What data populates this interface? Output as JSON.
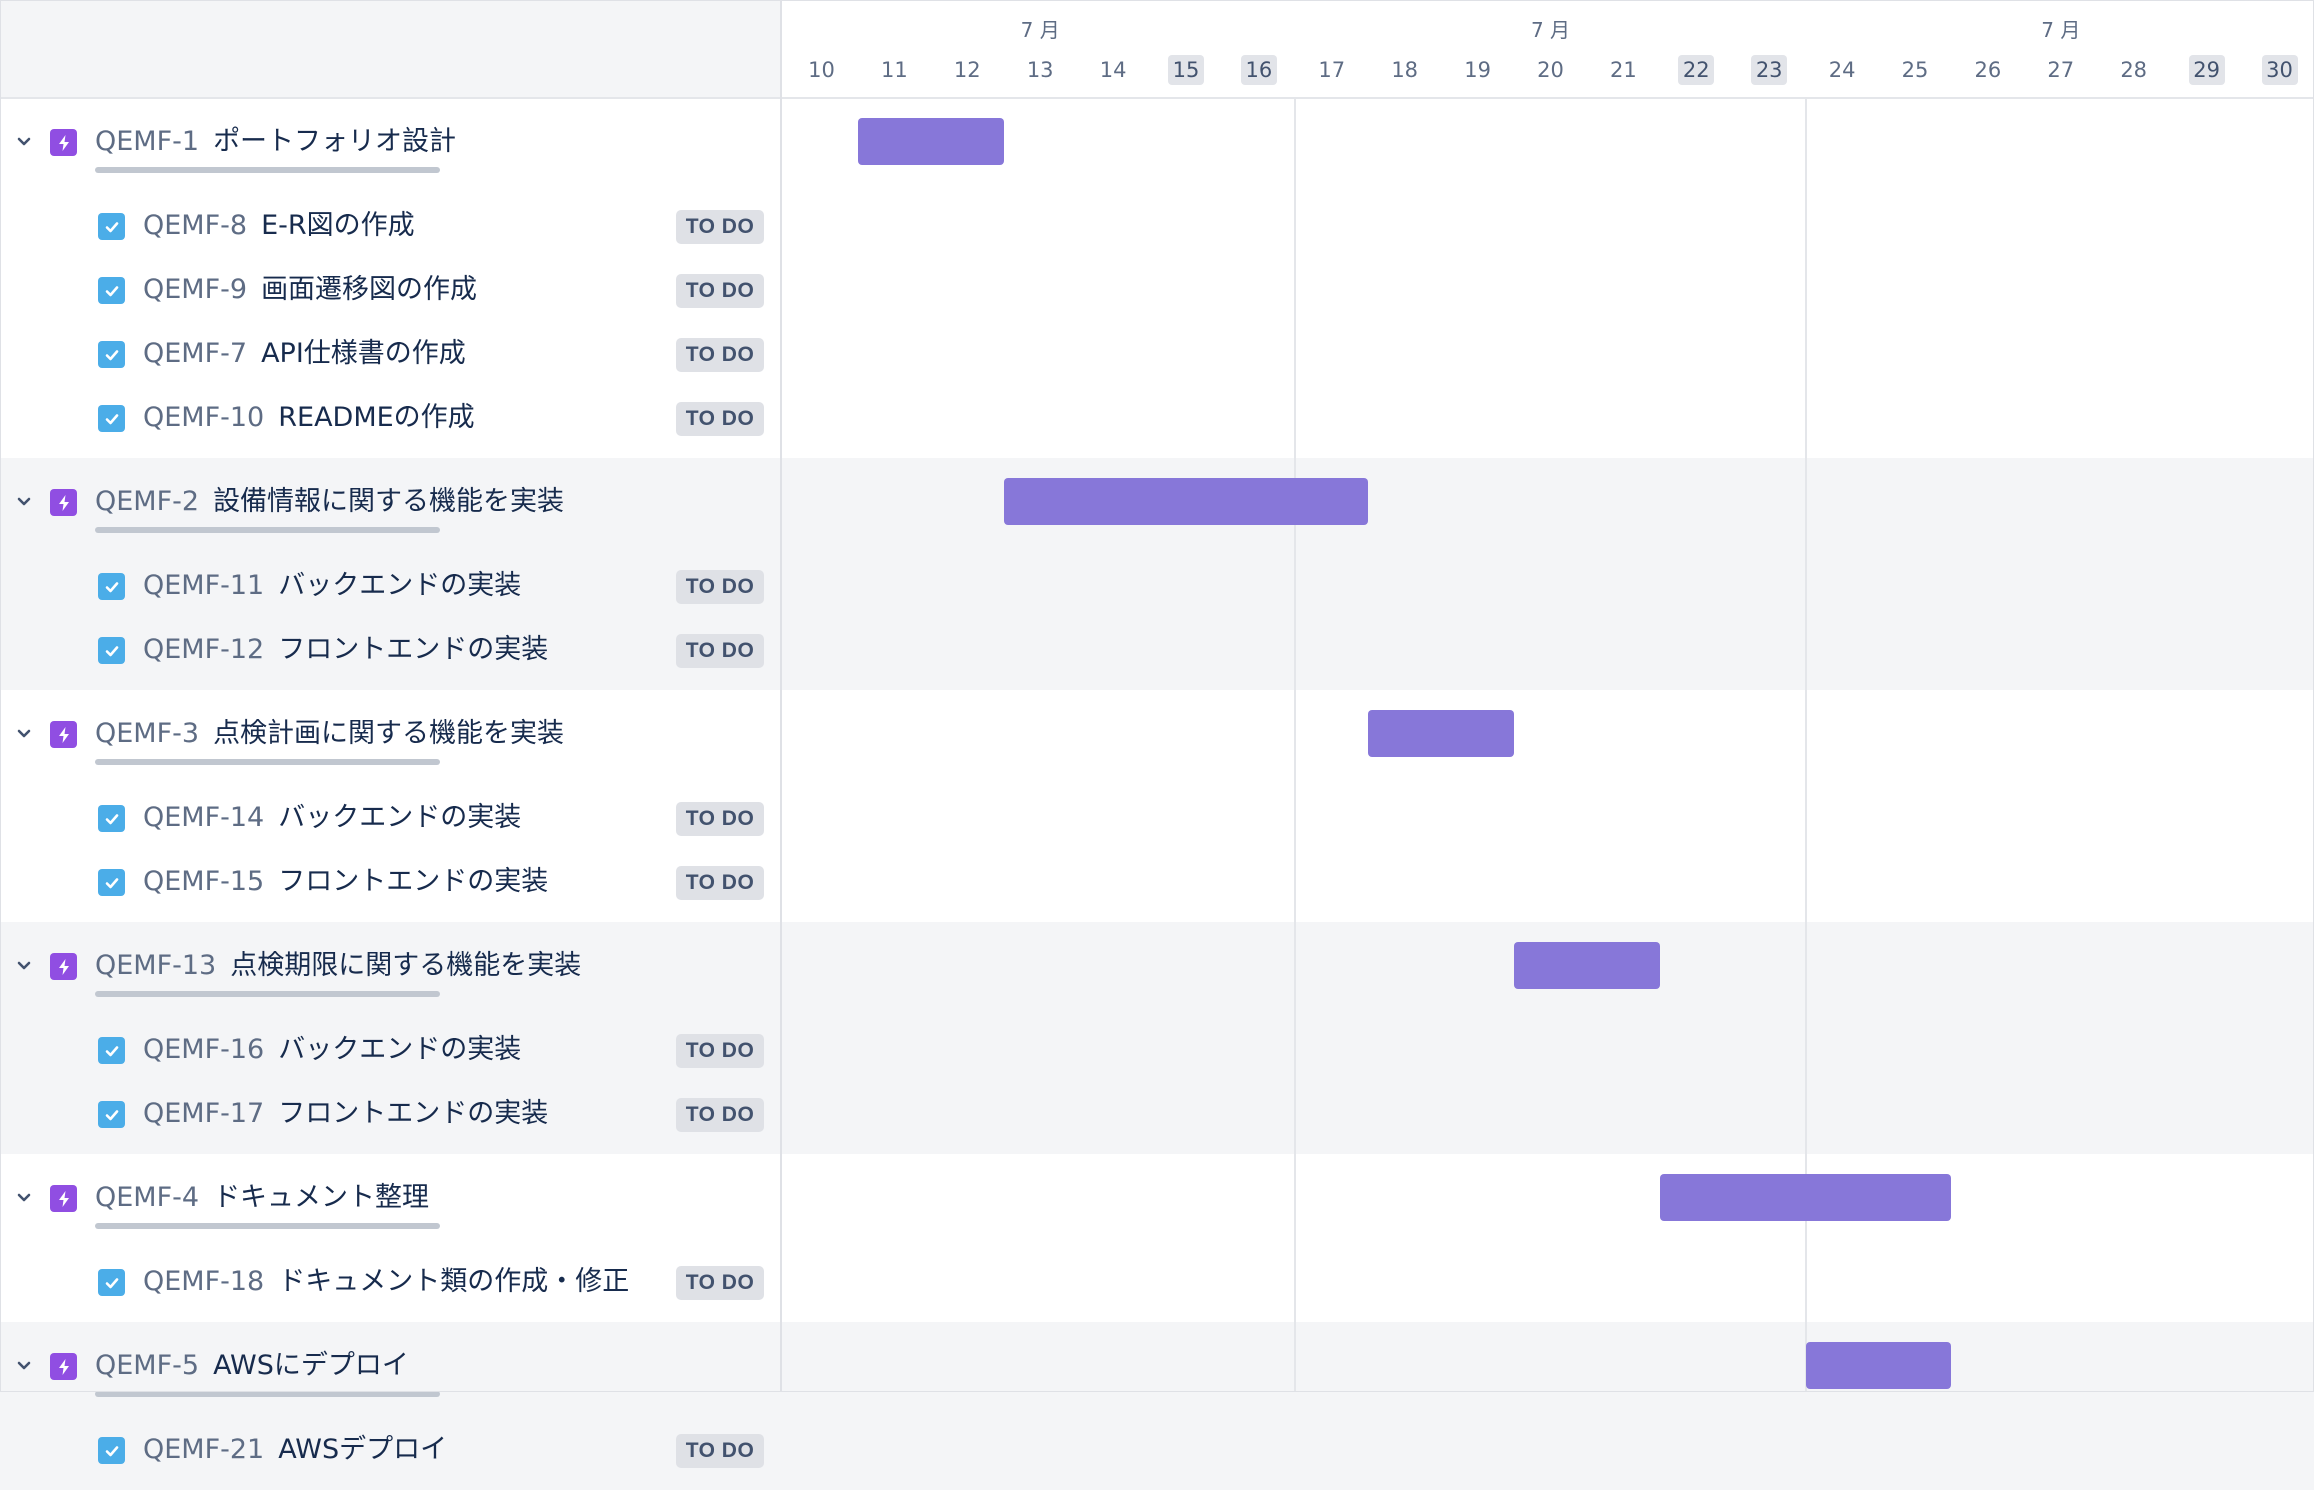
{
  "timeline": {
    "months": [
      "7 月",
      "7 月",
      "7 月"
    ],
    "days": [
      {
        "label": "10",
        "weekend": false
      },
      {
        "label": "11",
        "weekend": false
      },
      {
        "label": "12",
        "weekend": false
      },
      {
        "label": "13",
        "weekend": false
      },
      {
        "label": "14",
        "weekend": false
      },
      {
        "label": "15",
        "weekend": true
      },
      {
        "label": "16",
        "weekend": true
      },
      {
        "label": "17",
        "weekend": false
      },
      {
        "label": "18",
        "weekend": false
      },
      {
        "label": "19",
        "weekend": false
      },
      {
        "label": "20",
        "weekend": false
      },
      {
        "label": "21",
        "weekend": false
      },
      {
        "label": "22",
        "weekend": true
      },
      {
        "label": "23",
        "weekend": true
      },
      {
        "label": "24",
        "weekend": false
      },
      {
        "label": "25",
        "weekend": false
      },
      {
        "label": "26",
        "weekend": false
      },
      {
        "label": "27",
        "weekend": false
      },
      {
        "label": "28",
        "weekend": false
      },
      {
        "label": "29",
        "weekend": true
      },
      {
        "label": "30",
        "weekend": true
      }
    ]
  },
  "epics": [
    {
      "key": "QEMF-1",
      "summary": "ポートフォリオ設計",
      "start": "11",
      "end": "12",
      "children": [
        {
          "key": "QEMF-8",
          "summary": "E-R図の作成",
          "status": "TO DO"
        },
        {
          "key": "QEMF-9",
          "summary": "画面遷移図の作成",
          "status": "TO DO"
        },
        {
          "key": "QEMF-7",
          "summary": "API仕様書の作成",
          "status": "TO DO"
        },
        {
          "key": "QEMF-10",
          "summary": "READMEの作成",
          "status": "TO DO"
        }
      ]
    },
    {
      "key": "QEMF-2",
      "summary": "設備情報に関する機能を実装",
      "start": "13",
      "end": "17",
      "children": [
        {
          "key": "QEMF-11",
          "summary": "バックエンドの実装",
          "status": "TO DO"
        },
        {
          "key": "QEMF-12",
          "summary": "フロントエンドの実装",
          "status": "TO DO"
        }
      ]
    },
    {
      "key": "QEMF-3",
      "summary": "点検計画に関する機能を実装",
      "start": "18",
      "end": "19",
      "children": [
        {
          "key": "QEMF-14",
          "summary": "バックエンドの実装",
          "status": "TO DO"
        },
        {
          "key": "QEMF-15",
          "summary": "フロントエンドの実装",
          "status": "TO DO"
        }
      ]
    },
    {
      "key": "QEMF-13",
      "summary": "点検期限に関する機能を実装",
      "start": "20",
      "end": "21",
      "children": [
        {
          "key": "QEMF-16",
          "summary": "バックエンドの実装",
          "status": "TO DO"
        },
        {
          "key": "QEMF-17",
          "summary": "フロントエンドの実装",
          "status": "TO DO"
        }
      ]
    },
    {
      "key": "QEMF-4",
      "summary": "ドキュメント整理",
      "start": "22",
      "end": "25",
      "children": [
        {
          "key": "QEMF-18",
          "summary": "ドキュメント類の作成・修正",
          "status": "TO DO"
        }
      ]
    },
    {
      "key": "QEMF-5",
      "summary": "AWSにデプロイ",
      "start": "24",
      "end": "25",
      "children": [
        {
          "key": "QEMF-21",
          "summary": "AWSデプロイ",
          "status": "TO DO"
        }
      ]
    }
  ],
  "colors": {
    "epic_icon": "#904ee2",
    "task_icon": "#4bade8",
    "gantt_bar": "#8777d9",
    "status_badge_bg": "#dfe1e6",
    "band_shade": "#f4f5f7"
  },
  "icons": {
    "expand": "chevron-down-icon",
    "epic": "lightning-bolt-icon",
    "task": "checkbox-checked-icon"
  }
}
